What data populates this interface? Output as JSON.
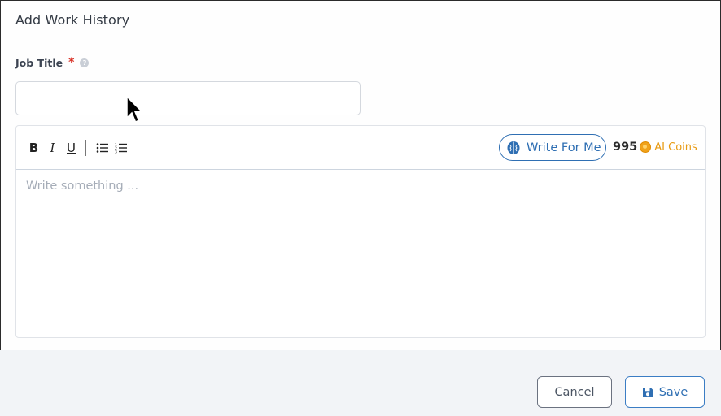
{
  "dialog": {
    "title": "Add Work History"
  },
  "form": {
    "job_title_label": "Job Title",
    "required_marker": "*",
    "help_icon": "?",
    "job_title_value": ""
  },
  "editor": {
    "toolbar": {
      "bold": "B",
      "italic": "I",
      "underline": "U",
      "bullet_list_icon": "bullet-list-icon",
      "numbered_list_icon": "numbered-list-icon"
    },
    "write_for_me_label": "Write For Me",
    "coins_count": "995",
    "coins_unit": "AI Coins",
    "placeholder": "Write something ..."
  },
  "footer": {
    "cancel_label": "Cancel",
    "save_label": "Save"
  },
  "colors": {
    "accent": "#2f6fb3",
    "required": "#d93025",
    "coin": "#f0a21b",
    "footer_bg": "#f2f4f7"
  }
}
